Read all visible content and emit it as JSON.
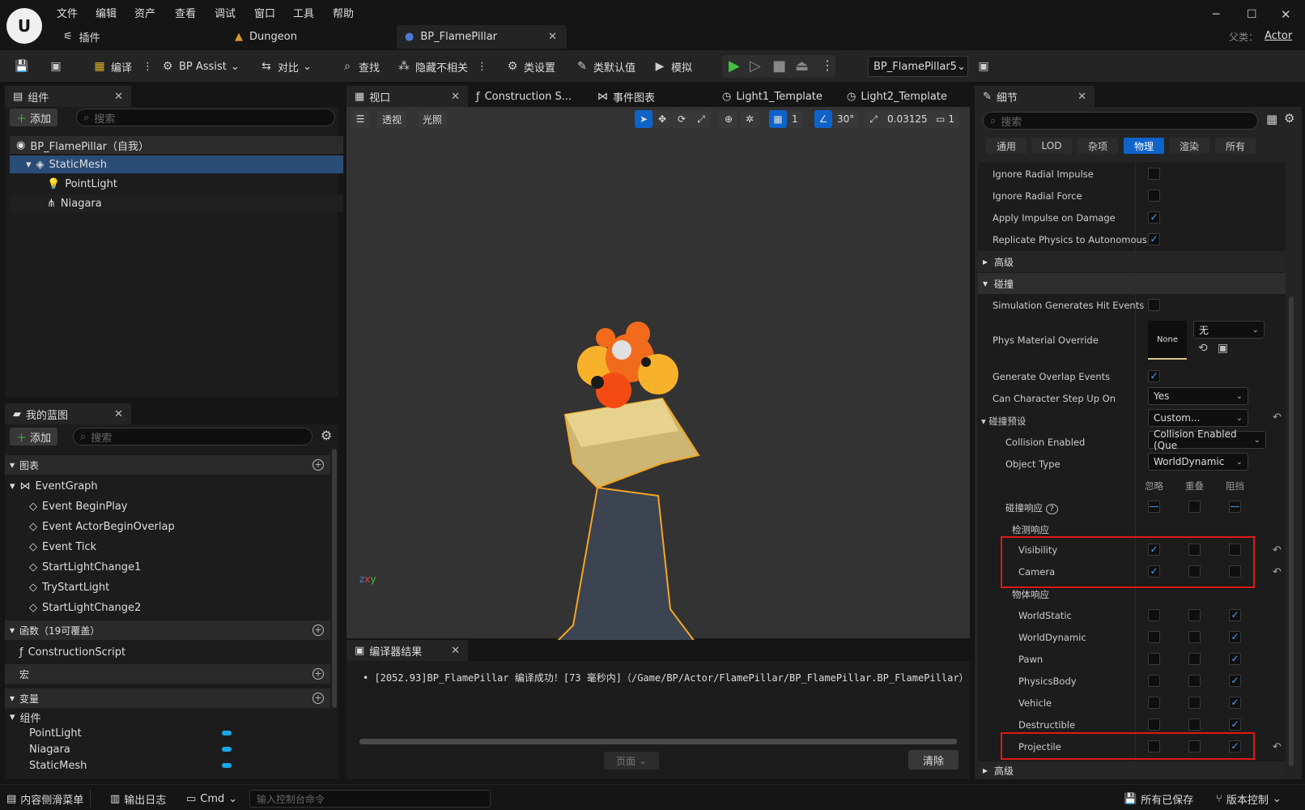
{
  "menu": [
    "文件",
    "编辑",
    "资产",
    "查看",
    "调试",
    "窗口",
    "工具",
    "帮助"
  ],
  "doc_tabs": {
    "plugins": "插件",
    "dungeon": "Dungeon",
    "blueprint": "BP_FlamePillar"
  },
  "parent_label": "父类：",
  "parent_value": "Actor",
  "toolbar": {
    "compile": "编译",
    "bp_assist": "BP Assist",
    "diff": "对比",
    "find": "查找",
    "hide_unrelated": "隐藏不相关",
    "class_settings": "类设置",
    "class_defaults": "类默认值",
    "simulate": "模拟",
    "debug_object": "BP_FlamePillar5"
  },
  "components": {
    "tab": "组件",
    "add": "添加",
    "search_placeholder": "搜索",
    "root": "BP_FlamePillar（自我）",
    "items": [
      "StaticMesh",
      "PointLight",
      "Niagara"
    ]
  },
  "myblueprint": {
    "tab": "我的蓝图",
    "add": "添加",
    "search_placeholder": "搜索",
    "graphs_label": "图表",
    "event_graph": "EventGraph",
    "events": [
      "Event BeginPlay",
      "Event ActorBeginOverlap",
      "Event Tick",
      "StartLightChange1",
      "TryStartLight",
      "StartLightChange2"
    ],
    "functions_label": "函数（19可覆盖）",
    "construction": "ConstructionScript",
    "macros_label": "宏",
    "variables_label": "变量",
    "components_label": "组件",
    "variables": [
      "PointLight",
      "Niagara",
      "StaticMesh"
    ]
  },
  "viewport_tabs": [
    "视口",
    "Construction S...",
    "事件图表",
    "Light1_Template",
    "Light2_Template"
  ],
  "viewport": {
    "perspective": "透视",
    "lit": "光照",
    "grid_size": "1",
    "angle": "30°",
    "scale": "0.03125",
    "camera_speed": "1"
  },
  "compiler": {
    "tab": "编译器结果",
    "message": "[2052.93]BP_FlamePillar 编译成功！[73 毫秒内]（/Game/BP/Actor/FlamePillar/BP_FlamePillar.BP_FlamePillar）",
    "page": "页面",
    "clear": "清除"
  },
  "details": {
    "tab": "细节",
    "search_placeholder": "搜索",
    "categories": [
      "通用",
      "LOD",
      "杂项",
      "物理",
      "渲染",
      "所有"
    ],
    "active_category": "物理",
    "physics_rows": [
      {
        "label": "Ignore Radial Impulse",
        "checked": false
      },
      {
        "label": "Ignore Radial Force",
        "checked": false
      },
      {
        "label": "Apply Impulse on Damage",
        "checked": true
      },
      {
        "label": "Replicate Physics to Autonomous...",
        "checked": true
      }
    ],
    "advanced": "高级",
    "collision": "碰撞",
    "sim_hit": "Simulation Generates Hit Events",
    "phys_mat": "Phys Material Override",
    "phys_mat_thumb": "None",
    "phys_mat_value": "无",
    "overlap": "Generate Overlap Events",
    "step_up": "Can Character Step Up On",
    "step_up_value": "Yes",
    "preset": "碰撞预设",
    "preset_value": "Custom...",
    "collision_enabled": "Collision Enabled",
    "collision_enabled_value": "Collision Enabled (Que",
    "object_type": "Object Type",
    "object_type_value": "WorldDynamic",
    "col_ignore": "忽略",
    "col_overlap": "重叠",
    "col_block": "阻挡",
    "collision_response": "碰撞响应",
    "trace_response": "检测响应",
    "trace_rows": [
      {
        "label": "Visibility",
        "state": "ignore"
      },
      {
        "label": "Camera",
        "state": "ignore"
      }
    ],
    "object_response": "物体响应",
    "object_rows": [
      {
        "label": "WorldStatic",
        "state": "block"
      },
      {
        "label": "WorldDynamic",
        "state": "block"
      },
      {
        "label": "Pawn",
        "state": "block"
      },
      {
        "label": "PhysicsBody",
        "state": "block"
      },
      {
        "label": "Vehicle",
        "state": "block"
      },
      {
        "label": "Destructible",
        "state": "block"
      },
      {
        "label": "Projectile",
        "state": "block"
      }
    ],
    "advanced2": "高级"
  },
  "statusbar": {
    "content_drawer": "内容侧滑菜单",
    "output_log": "输出日志",
    "cmd": "Cmd",
    "console_placeholder": "输入控制台命令",
    "saved": "所有已保存",
    "source_control": "版本控制"
  }
}
